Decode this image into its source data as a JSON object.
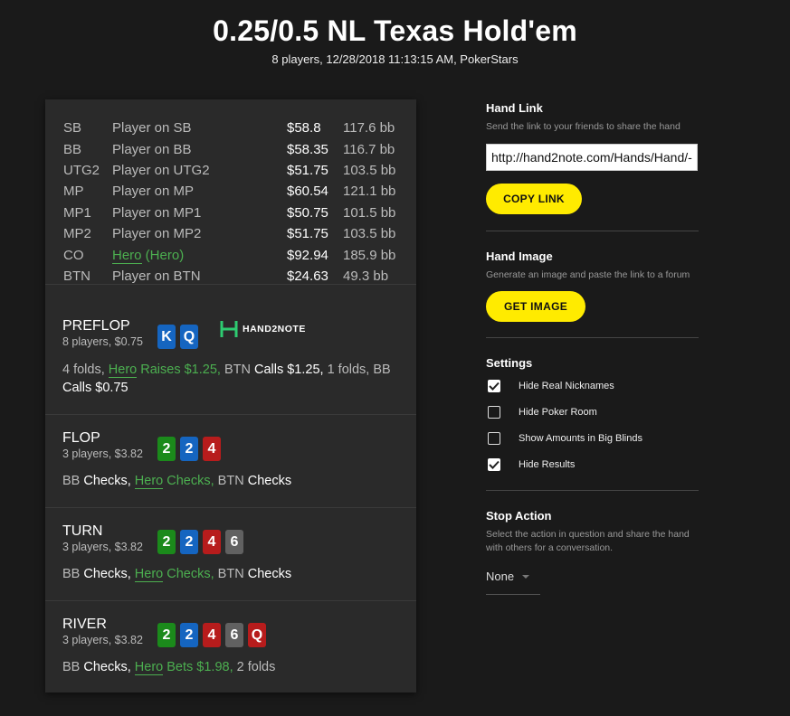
{
  "header": {
    "title": "0.25/0.5 NL Texas Hold'em",
    "subtitle": "8 players, 12/28/2018 11:13:15 AM, PokerStars"
  },
  "players": [
    {
      "pos": "SB",
      "name": "Player on SB",
      "stack": "$58.8",
      "bb": "117.6 bb",
      "hero": false
    },
    {
      "pos": "BB",
      "name": "Player on BB",
      "stack": "$58.35",
      "bb": "116.7 bb",
      "hero": false
    },
    {
      "pos": "UTG2",
      "name": "Player on UTG2",
      "stack": "$51.75",
      "bb": "103.5 bb",
      "hero": false
    },
    {
      "pos": "MP",
      "name": "Player on MP",
      "stack": "$60.54",
      "bb": "121.1 bb",
      "hero": false
    },
    {
      "pos": "MP1",
      "name": "Player on MP1",
      "stack": "$50.75",
      "bb": "101.5 bb",
      "hero": false
    },
    {
      "pos": "MP2",
      "name": "Player on MP2",
      "stack": "$51.75",
      "bb": "103.5 bb",
      "hero": false
    },
    {
      "pos": "CO",
      "name": "Hero",
      "name_suffix": " (Hero)",
      "stack": "$92.94",
      "bb": "185.9 bb",
      "hero": true
    },
    {
      "pos": "BTN",
      "name": "Player on BTN",
      "stack": "$24.63",
      "bb": "49.3 bb",
      "hero": false
    }
  ],
  "logo": {
    "text": "HAND2NOTE"
  },
  "streets": {
    "preflop": {
      "name": "PREFLOP",
      "info": "8 players, $0.75",
      "cards": [
        {
          "rank": "K",
          "color": "#1565c0"
        },
        {
          "rank": "Q",
          "color": "#1565c0"
        }
      ],
      "a1": "4 folds, ",
      "a2_hero": "Hero",
      "a2_rest": " Raises $1.25,",
      "a3": " BTN ",
      "a4": "Calls $1.25,",
      "a5": " 1 folds, BB ",
      "a6": "Calls $0.75"
    },
    "flop": {
      "name": "FLOP",
      "info": "3 players, $3.82",
      "cards": [
        {
          "rank": "2",
          "color": "#1b8a1b"
        },
        {
          "rank": "2",
          "color": "#1565c0"
        },
        {
          "rank": "4",
          "color": "#b71c1c"
        }
      ],
      "a1": "BB ",
      "a2": "Checks,",
      "a3_hero": "Hero",
      "a3_rest": " Checks,",
      "a4": " BTN ",
      "a5": "Checks"
    },
    "turn": {
      "name": "TURN",
      "info": "3 players, $3.82",
      "cards": [
        {
          "rank": "2",
          "color": "#1b8a1b"
        },
        {
          "rank": "2",
          "color": "#1565c0"
        },
        {
          "rank": "4",
          "color": "#b71c1c"
        },
        {
          "rank": "6",
          "color": "#616161"
        }
      ],
      "a1": "BB ",
      "a2": "Checks,",
      "a3_hero": "Hero",
      "a3_rest": " Checks,",
      "a4": " BTN ",
      "a5": "Checks"
    },
    "river": {
      "name": "RIVER",
      "info": "3 players, $3.82",
      "cards": [
        {
          "rank": "2",
          "color": "#1b8a1b"
        },
        {
          "rank": "2",
          "color": "#1565c0"
        },
        {
          "rank": "4",
          "color": "#b71c1c"
        },
        {
          "rank": "6",
          "color": "#616161"
        },
        {
          "rank": "Q",
          "color": "#b71c1c"
        }
      ],
      "a1": "BB ",
      "a2": "Checks,",
      "a3_hero": "Hero",
      "a3_rest": " Bets $1.98,",
      "a4": " 2 folds"
    }
  },
  "sidebar": {
    "hand_link": {
      "title": "Hand Link",
      "desc": "Send the link to your friends to share the hand",
      "url": "http://hand2note.com/Hands/Hand/-",
      "button": "COPY LINK"
    },
    "hand_image": {
      "title": "Hand Image",
      "desc": "Generate an image and paste the link to a forum",
      "button": "GET IMAGE"
    },
    "settings": {
      "title": "Settings",
      "options": [
        {
          "label": "Hide Real Nicknames",
          "checked": true
        },
        {
          "label": "Hide Poker Room",
          "checked": false
        },
        {
          "label": "Show Amounts in Big Blinds",
          "checked": false
        },
        {
          "label": "Hide Results",
          "checked": true
        }
      ]
    },
    "stop_action": {
      "title": "Stop Action",
      "desc": "Select the action in question and share the hand with others for a conversation.",
      "value": "None"
    }
  },
  "colors": {
    "accent_yellow": "#ffeb00",
    "hero_green": "#4caf50",
    "panel": "#2a2a2a",
    "background": "#1a1a1a"
  }
}
